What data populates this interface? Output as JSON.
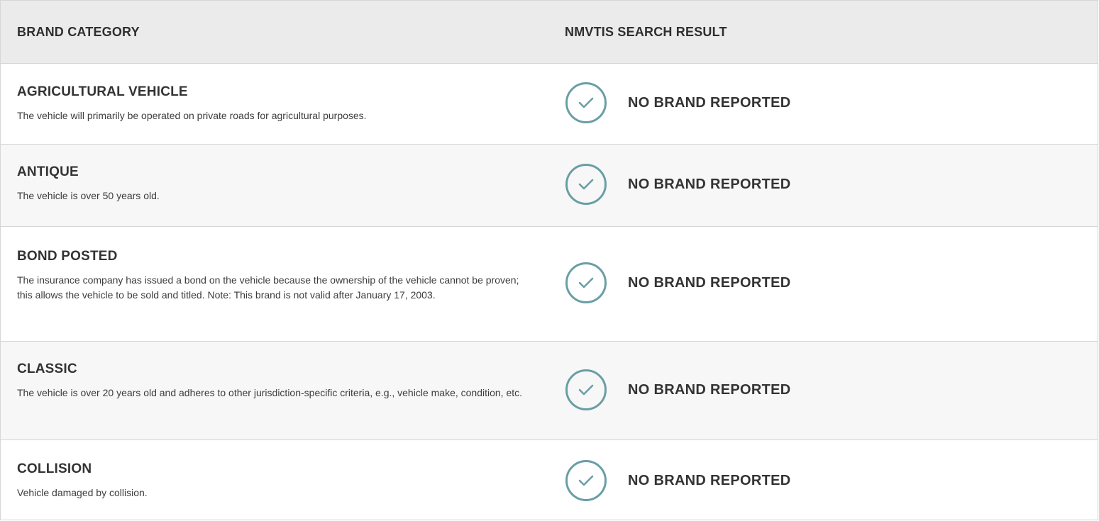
{
  "header": {
    "brand_category": "BRAND CATEGORY",
    "search_result": "NMVTIS SEARCH RESULT"
  },
  "rows": [
    {
      "title": "AGRICULTURAL VEHICLE",
      "description": "The vehicle will primarily be operated on private roads for agricultural purposes.",
      "result": "NO BRAND REPORTED",
      "icon": "check-circle-icon"
    },
    {
      "title": "ANTIQUE",
      "description": "The vehicle is over 50 years old.",
      "result": "NO BRAND REPORTED",
      "icon": "check-circle-icon"
    },
    {
      "title": "BOND POSTED",
      "description": "The insurance company has issued a bond on the vehicle because the ownership of the vehicle cannot be proven; this allows the vehicle to be sold and titled. Note: This brand is not valid after January 17, 2003.",
      "result": "NO BRAND REPORTED",
      "icon": "check-circle-icon"
    },
    {
      "title": "CLASSIC",
      "description": "The vehicle is over 20 years old and adheres to other jurisdiction-specific criteria, e.g., vehicle make, condition, etc.",
      "result": "NO BRAND REPORTED",
      "icon": "check-circle-icon"
    },
    {
      "title": "COLLISION",
      "description": "Vehicle damaged by collision.",
      "result": "NO BRAND REPORTED",
      "icon": "check-circle-icon"
    }
  ],
  "colors": {
    "header_bg": "#ebebeb",
    "alt_row_bg": "#f7f7f7",
    "check_accent": "#6a9ea6",
    "border": "#d6d6d6"
  }
}
